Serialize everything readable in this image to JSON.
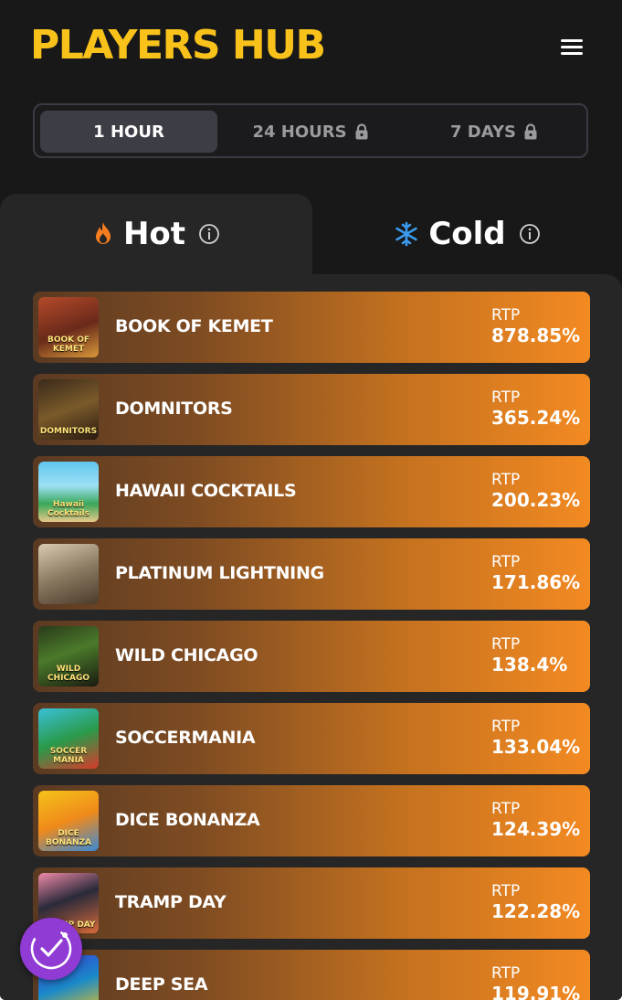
{
  "header": {
    "title": "PLAYERS HUB",
    "menu_icon": "hamburger-menu-icon"
  },
  "period_tabs": [
    {
      "label": "1 HOUR",
      "active": true,
      "locked": false
    },
    {
      "label": "24 HOURS",
      "active": false,
      "locked": true
    },
    {
      "label": "7 DAYS",
      "active": false,
      "locked": true
    }
  ],
  "temperature_tabs": {
    "hot": {
      "label": "Hot",
      "icon": "flame-icon",
      "active": true
    },
    "cold": {
      "label": "Cold",
      "icon": "snowflake-icon",
      "active": false
    }
  },
  "games": [
    {
      "name": "BOOK OF KEMET",
      "rtp_label": "RTP",
      "rtp_value": "878.85%",
      "thumb_text": "BOOK OF KEMET"
    },
    {
      "name": "DOMNITORS",
      "rtp_label": "RTP",
      "rtp_value": "365.24%",
      "thumb_text": "DOMNITORS"
    },
    {
      "name": "HAWAII COCKTAILS",
      "rtp_label": "RTP",
      "rtp_value": "200.23%",
      "thumb_text": "Hawaii Cocktails"
    },
    {
      "name": "PLATINUM LIGHTNING",
      "rtp_label": "RTP",
      "rtp_value": "171.86%",
      "thumb_text": ""
    },
    {
      "name": "WILD CHICAGO",
      "rtp_label": "RTP",
      "rtp_value": "138.4%",
      "thumb_text": "WILD CHICAGO"
    },
    {
      "name": "SOCCERMANIA",
      "rtp_label": "RTP",
      "rtp_value": "133.04%",
      "thumb_text": "SOCCER MANIA"
    },
    {
      "name": "DICE BONANZA",
      "rtp_label": "RTP",
      "rtp_value": "124.39%",
      "thumb_text": "DICE BONANZA"
    },
    {
      "name": "TRAMP DAY",
      "rtp_label": "RTP",
      "rtp_value": "122.28%",
      "thumb_text": "TRAMP DAY"
    },
    {
      "name": "DEEP SEA",
      "rtp_label": "RTP",
      "rtp_value": "119.91%",
      "thumb_text": ""
    }
  ],
  "colors": {
    "accent": "#f9c21b",
    "background": "#181818",
    "panel": "#262626",
    "card_start": "#5a3a22",
    "card_end": "#f38a22",
    "snowflake": "#3a9cf0",
    "flame": "#f57c1f",
    "widget": "#8f3bd4"
  },
  "accessibility_widget": {
    "icon": "accessibility-icon"
  }
}
